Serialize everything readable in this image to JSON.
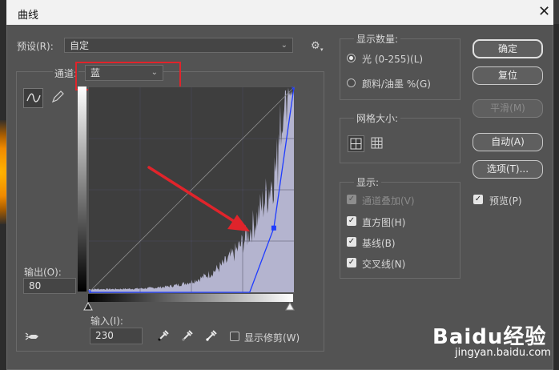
{
  "window": {
    "title": "曲线",
    "close_label": "✕"
  },
  "preset": {
    "label": "预设(R):",
    "value": "自定"
  },
  "channel": {
    "label": "通道:",
    "value": "蓝"
  },
  "output": {
    "label": "输出(O):",
    "value": "80"
  },
  "input": {
    "label": "输入(I):",
    "value": "230"
  },
  "show_clipping": {
    "label": "显示修剪(W)",
    "checked": false
  },
  "display_amount": {
    "title": "显示数量:",
    "options": [
      {
        "label": "光 (0-255)(L)",
        "selected": true
      },
      {
        "label": "颜料/油墨 %(G)",
        "selected": false
      }
    ]
  },
  "grid_size": {
    "title": "网格大小:"
  },
  "show": {
    "title": "显示:",
    "options": [
      {
        "label": "通道叠加(V)",
        "checked": true,
        "disabled": true
      },
      {
        "label": "直方图(H)",
        "checked": true,
        "disabled": false
      },
      {
        "label": "基线(B)",
        "checked": true,
        "disabled": false
      },
      {
        "label": "交叉线(N)",
        "checked": true,
        "disabled": false
      }
    ]
  },
  "buttons": {
    "ok": "确定",
    "reset": "复位",
    "smooth": "平滑(M)",
    "auto": "自动(A)",
    "options": "选项(T)..."
  },
  "preview": {
    "label": "预览(P)",
    "checked": true
  },
  "curve": {
    "channel_color": "#1f3cff",
    "points": [
      [
        0,
        0
      ],
      [
        230,
        80
      ],
      [
        255,
        255
      ]
    ]
  },
  "watermark": {
    "brand": "Baidu经验",
    "url": "jingyan.baidu.com"
  },
  "colors": {
    "highlight_box": "#e0242b",
    "arrow": "#e0242b",
    "histogram": "#b4b4cf"
  }
}
